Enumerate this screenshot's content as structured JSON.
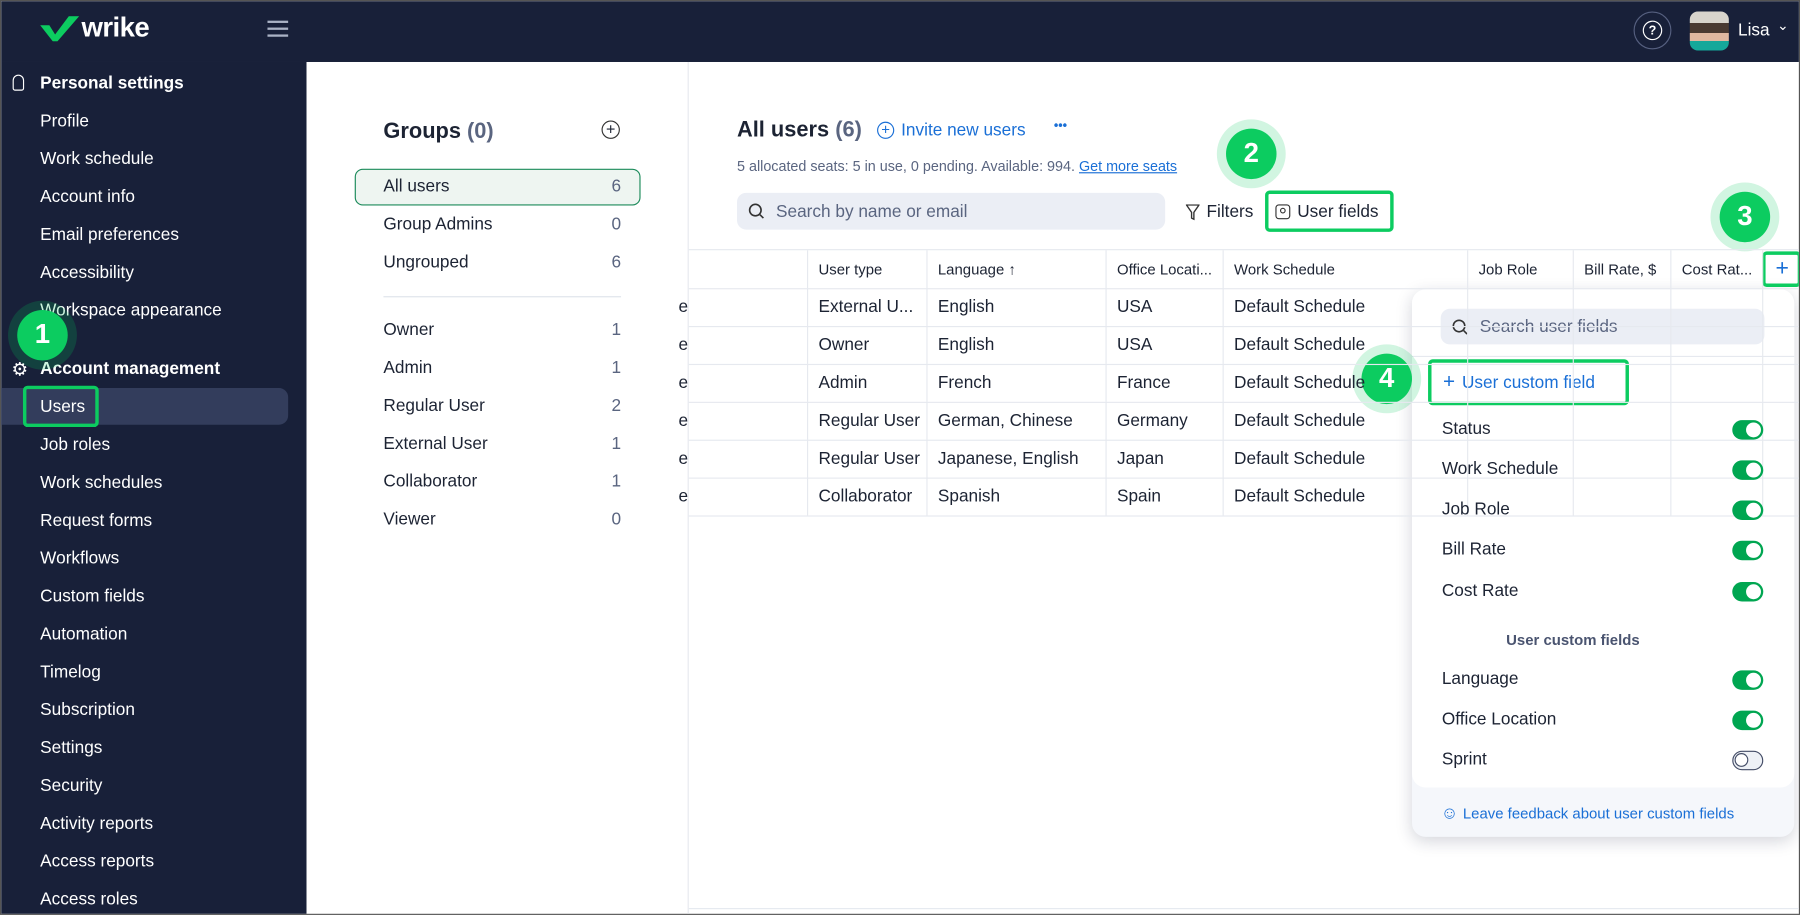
{
  "topbar": {
    "brand": "wrike",
    "user_name": "Lisa",
    "icons": [
      "hamburger-icon",
      "help-icon",
      "avatar",
      "chevron-down-icon"
    ]
  },
  "sidebar": {
    "personal_header": "Personal settings",
    "personal_items": [
      "Profile",
      "Work schedule",
      "Account info",
      "Email preferences",
      "Accessibility",
      "Workspace appearance"
    ],
    "account_header": "Account management",
    "account_items": [
      "Users",
      "Job roles",
      "Work schedules",
      "Request forms",
      "Workflows",
      "Custom fields",
      "Automation",
      "Timelog",
      "Subscription",
      "Settings",
      "Security",
      "Activity reports",
      "Access reports",
      "Access roles"
    ],
    "active": "Users"
  },
  "groups": {
    "title": "Groups",
    "count": "(0)",
    "items": [
      {
        "label": "All users",
        "count": "6"
      },
      {
        "label": "Group Admins",
        "count": "0"
      },
      {
        "label": "Ungrouped",
        "count": "6"
      }
    ],
    "roles": [
      {
        "label": "Owner",
        "count": "1"
      },
      {
        "label": "Admin",
        "count": "1"
      },
      {
        "label": "Regular User",
        "count": "2"
      },
      {
        "label": "External User",
        "count": "1"
      },
      {
        "label": "Collaborator",
        "count": "1"
      },
      {
        "label": "Viewer",
        "count": "0"
      }
    ]
  },
  "main": {
    "title": "All users",
    "count": "(6)",
    "invite_label": "Invite new users",
    "more_label": "•••",
    "seats_text": "5 allocated seats: 5 in use, 0 pending. Available: 994.",
    "seats_link": "Get more seats",
    "search_placeholder": "Search by name or email",
    "filters_label": "Filters",
    "user_fields_label": "User fields"
  },
  "table": {
    "columns": [
      "",
      "User type",
      "Language ↑",
      "Office Locati...",
      "Work Schedule",
      "Job Role",
      "Bill Rate, $",
      "Cost Rat..."
    ],
    "rows": [
      [
        "e",
        "External U...",
        "English",
        "USA",
        "Default Schedule",
        "",
        "",
        ""
      ],
      [
        "e",
        "Owner",
        "English",
        "USA",
        "Default Schedule",
        "",
        "",
        ""
      ],
      [
        "e",
        "Admin",
        "French",
        "France",
        "Default Schedule",
        "",
        "",
        ""
      ],
      [
        "e",
        "Regular User",
        "German, Chinese",
        "Germany",
        "Default Schedule",
        "",
        "",
        ""
      ],
      [
        "e",
        "Regular User",
        "Japanese, English",
        "Japan",
        "Default Schedule",
        "",
        "",
        ""
      ],
      [
        "e",
        "Collaborator",
        "Spanish",
        "Spain",
        "Default Schedule",
        "",
        "",
        ""
      ]
    ],
    "add_column_label": "+"
  },
  "dropdown": {
    "search_placeholder": "Search user fields",
    "add_label": "User custom field",
    "fields": [
      {
        "label": "Status",
        "on": true
      },
      {
        "label": "Work Schedule",
        "on": true
      },
      {
        "label": "Job Role",
        "on": true
      },
      {
        "label": "Bill Rate",
        "on": true
      },
      {
        "label": "Cost Rate",
        "on": true
      }
    ],
    "custom_header": "User custom fields",
    "custom_fields": [
      {
        "label": "Language",
        "on": true
      },
      {
        "label": "Office Location",
        "on": true
      },
      {
        "label": "Sprint",
        "on": false
      }
    ],
    "feedback_label": "Leave feedback about user custom fields"
  },
  "annotations": [
    "1",
    "2",
    "3",
    "4"
  ],
  "colors": {
    "nav_bg": "#182039",
    "accent_blue": "#1a6fd6",
    "toggle_on": "#00a651",
    "annotation_green": "#0ccc60"
  }
}
